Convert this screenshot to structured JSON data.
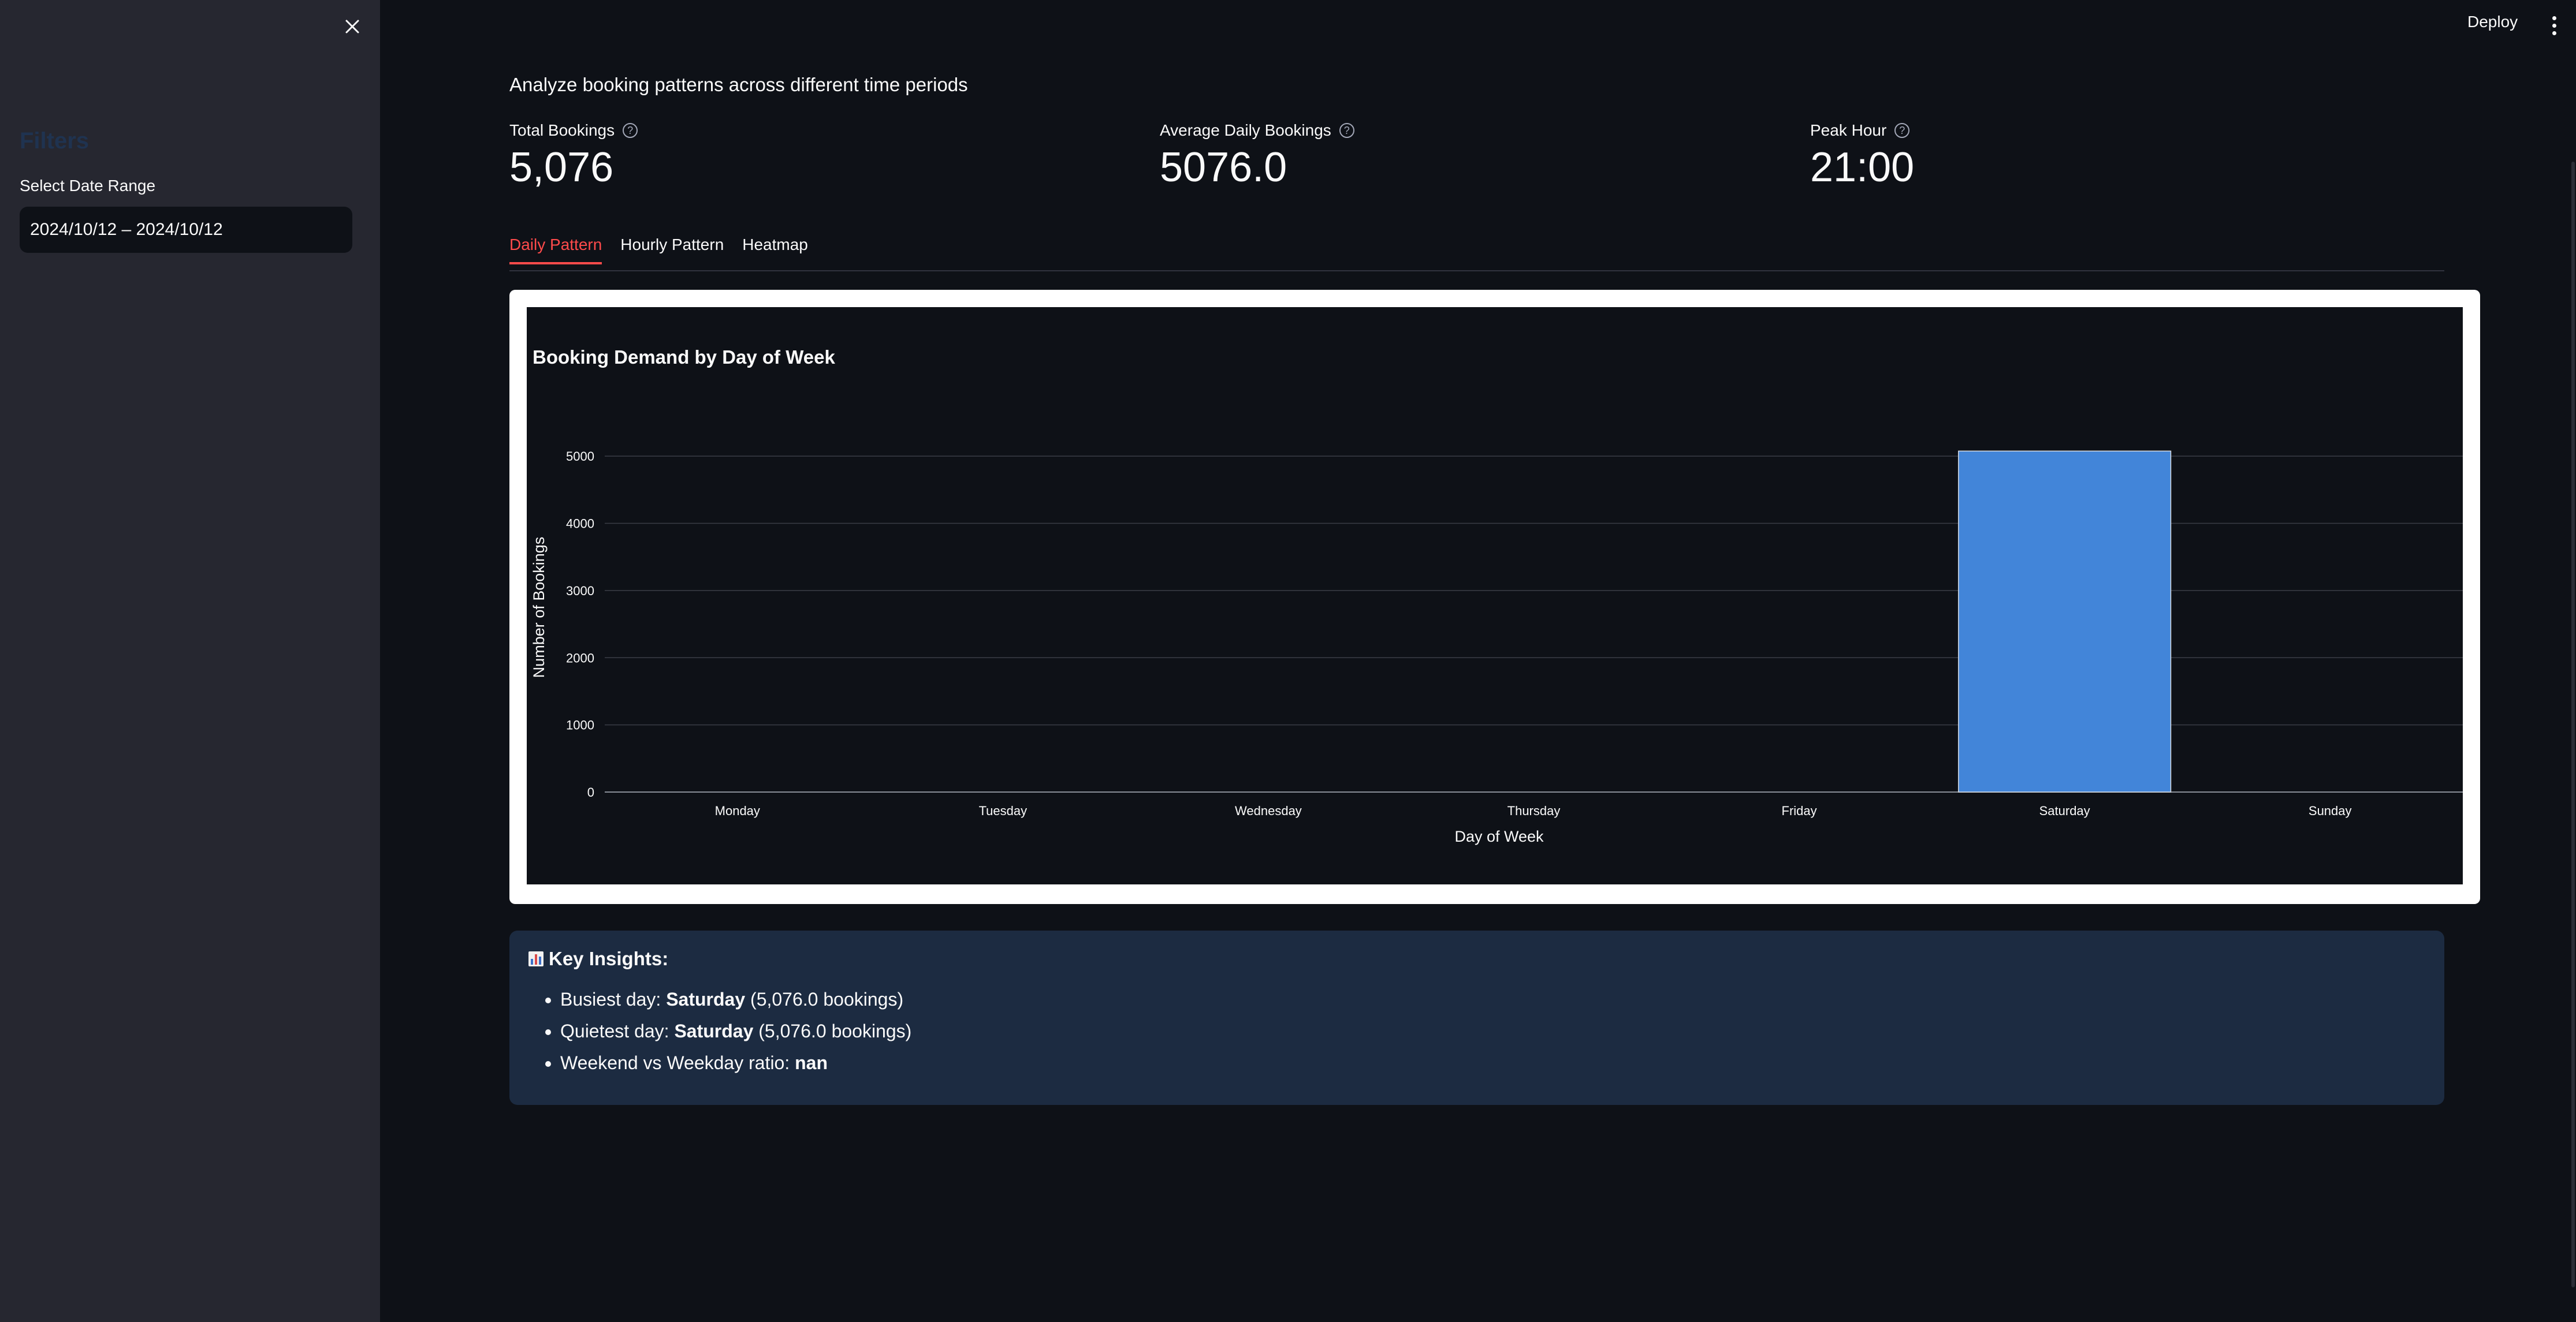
{
  "sidebar": {
    "close_icon": "close-icon",
    "title": "Filters",
    "date_range_label": "Select Date Range",
    "date_range_value": "2024/10/12 – 2024/10/12"
  },
  "header": {
    "deploy_label": "Deploy",
    "menu_icon": "vertical-dots-icon"
  },
  "main": {
    "subtitle": "Analyze booking patterns across different time periods",
    "metrics": [
      {
        "label": "Total Bookings",
        "value": "5,076",
        "help_icon": "question-circle-icon"
      },
      {
        "label": "Average Daily Bookings",
        "value": "5076.0",
        "help_icon": "question-circle-icon"
      },
      {
        "label": "Peak Hour",
        "value": "21:00",
        "help_icon": "question-circle-icon"
      }
    ],
    "tabs": [
      {
        "label": "Daily Pattern",
        "active": true
      },
      {
        "label": "Hourly Pattern",
        "active": false
      },
      {
        "label": "Heatmap",
        "active": false
      }
    ],
    "accent_color": "#ff4b4b",
    "bar_color": "#4285d9"
  },
  "chart_data": {
    "type": "bar",
    "title": "Booking Demand by Day of Week",
    "xlabel": "Day of Week",
    "ylabel": "Number of Bookings",
    "categories": [
      "Monday",
      "Tuesday",
      "Wednesday",
      "Thursday",
      "Friday",
      "Saturday",
      "Sunday"
    ],
    "values": [
      0,
      0,
      0,
      0,
      0,
      5076,
      0
    ],
    "yticks": [
      0,
      1000,
      2000,
      3000,
      4000,
      5000
    ],
    "ylim": [
      0,
      5500
    ],
    "grid": true
  },
  "insights": {
    "icon": "bar-chart-icon",
    "title": "Key Insights:",
    "items": [
      {
        "prefix": "Busiest day: ",
        "bold": "Saturday",
        "suffix": " (5,076.0 bookings)"
      },
      {
        "prefix": "Quietest day: ",
        "bold": "Saturday",
        "suffix": " (5,076.0 bookings)"
      },
      {
        "prefix": "Weekend vs Weekday ratio: ",
        "bold": "nan",
        "suffix": ""
      }
    ]
  }
}
